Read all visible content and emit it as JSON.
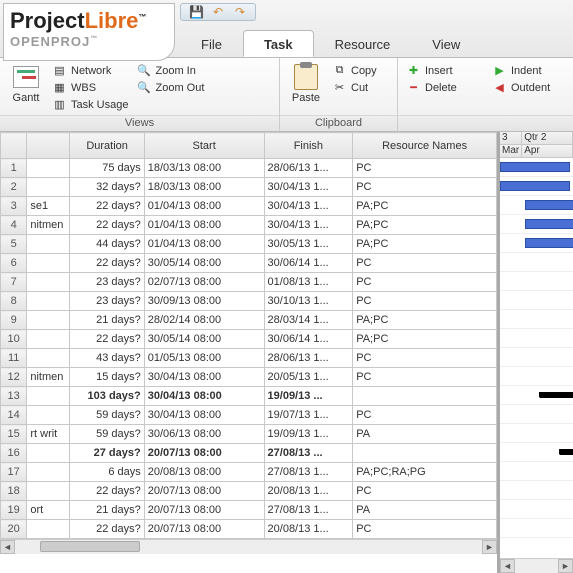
{
  "app": {
    "logo_left": "Project",
    "logo_right": "Libre",
    "logo_tm": "™",
    "logo_sub": "OPENPROJ",
    "logo_sub_tm": "™"
  },
  "tabs": {
    "file": "File",
    "task": "Task",
    "resource": "Resource",
    "view": "View"
  },
  "ribbon": {
    "views": {
      "label": "Views",
      "gantt": "Gantt",
      "network": "Network",
      "wbs": "WBS",
      "task_usage": "Task Usage",
      "zoom_in": "Zoom In",
      "zoom_out": "Zoom Out"
    },
    "clipboard": {
      "label": "Clipboard",
      "paste": "Paste",
      "copy": "Copy",
      "cut": "Cut"
    },
    "editing": {
      "insert": "Insert",
      "delete": "Delete",
      "indent": "Indent",
      "outdent": "Outdent"
    }
  },
  "columns": {
    "corner": "",
    "name": "",
    "duration": "Duration",
    "start": "Start",
    "finish": "Finish",
    "resources": "Resource Names"
  },
  "timeline": {
    "q1": "3",
    "q2": "Qtr 2",
    "m1": "Mar",
    "m2": "Apr"
  },
  "rows": [
    {
      "n": "1",
      "name": "",
      "dur": "75 days",
      "s": "18/03/13 08:00",
      "f": "28/06/13 1...",
      "r": "PC",
      "bold": false
    },
    {
      "n": "2",
      "name": "",
      "dur": "32 days?",
      "s": "18/03/13 08:00",
      "f": "30/04/13 1...",
      "r": "PC",
      "bold": false
    },
    {
      "n": "3",
      "name": "se1",
      "dur": "22 days?",
      "s": "01/04/13 08:00",
      "f": "30/04/13 1...",
      "r": "PA;PC",
      "bold": false
    },
    {
      "n": "4",
      "name": "nitmen",
      "dur": "22 days?",
      "s": "01/04/13 08:00",
      "f": "30/04/13 1...",
      "r": "PA;PC",
      "bold": false
    },
    {
      "n": "5",
      "name": "",
      "dur": "44 days?",
      "s": "01/04/13 08:00",
      "f": "30/05/13 1...",
      "r": "PA;PC",
      "bold": false
    },
    {
      "n": "6",
      "name": "",
      "dur": "22 days?",
      "s": "30/05/14 08:00",
      "f": "30/06/14 1...",
      "r": "PC",
      "bold": false
    },
    {
      "n": "7",
      "name": "",
      "dur": "23 days?",
      "s": "02/07/13 08:00",
      "f": "01/08/13 1...",
      "r": "PC",
      "bold": false
    },
    {
      "n": "8",
      "name": "",
      "dur": "23 days?",
      "s": "30/09/13 08:00",
      "f": "30/10/13 1...",
      "r": "PC",
      "bold": false
    },
    {
      "n": "9",
      "name": "",
      "dur": "21 days?",
      "s": "28/02/14 08:00",
      "f": "28/03/14 1...",
      "r": "PA;PC",
      "bold": false
    },
    {
      "n": "10",
      "name": "",
      "dur": "22 days?",
      "s": "30/05/14 08:00",
      "f": "30/06/14 1...",
      "r": "PA;PC",
      "bold": false
    },
    {
      "n": "11",
      "name": "",
      "dur": "43 days?",
      "s": "01/05/13 08:00",
      "f": "28/06/13 1...",
      "r": "PC",
      "bold": false
    },
    {
      "n": "12",
      "name": "nitmen",
      "dur": "15 days?",
      "s": "30/04/13 08:00",
      "f": "20/05/13 1...",
      "r": "PC",
      "bold": false
    },
    {
      "n": "13",
      "name": "",
      "dur": "103 days?",
      "s": "30/04/13 08:00",
      "f": "19/09/13 ...",
      "r": "",
      "bold": true
    },
    {
      "n": "14",
      "name": "",
      "dur": "59 days?",
      "s": "30/04/13 08:00",
      "f": "19/07/13 1...",
      "r": "PC",
      "bold": false
    },
    {
      "n": "15",
      "name": "rt writ",
      "dur": "59 days?",
      "s": "30/06/13 08:00",
      "f": "19/09/13 1...",
      "r": "PA",
      "bold": false
    },
    {
      "n": "16",
      "name": "",
      "dur": "27 days?",
      "s": "20/07/13 08:00",
      "f": "27/08/13 ...",
      "r": "",
      "bold": true
    },
    {
      "n": "17",
      "name": "",
      "dur": "6 days",
      "s": "20/08/13 08:00",
      "f": "27/08/13 1...",
      "r": "PA;PC;RA;PG",
      "bold": false
    },
    {
      "n": "18",
      "name": "",
      "dur": "22 days?",
      "s": "20/07/13 08:00",
      "f": "20/08/13 1...",
      "r": "PC",
      "bold": false
    },
    {
      "n": "19",
      "name": "ort",
      "dur": "21 days?",
      "s": "20/07/13 08:00",
      "f": "27/08/13 1...",
      "r": "PA",
      "bold": false
    },
    {
      "n": "20",
      "name": "",
      "dur": "22 days?",
      "s": "20/07/13 08:00",
      "f": "20/08/13 1...",
      "r": "PC",
      "bold": false
    }
  ]
}
